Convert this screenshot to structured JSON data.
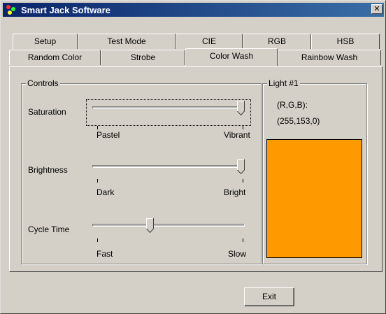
{
  "window": {
    "title": "Smart Jack Software",
    "close_label": "✕"
  },
  "tabs_row1": [
    {
      "label": "Setup"
    },
    {
      "label": "Test Mode"
    },
    {
      "label": "CIE"
    },
    {
      "label": "RGB"
    },
    {
      "label": "HSB"
    }
  ],
  "tabs_row2": [
    {
      "label": "Random Color"
    },
    {
      "label": "Strobe"
    },
    {
      "label": "Color Wash",
      "active": true
    },
    {
      "label": "Rainbow Wash"
    }
  ],
  "controls": {
    "group_label": "Controls",
    "saturation": {
      "label": "Saturation",
      "min_label": "Pastel",
      "max_label": "Vibrant",
      "value": 1.0
    },
    "brightness": {
      "label": "Brightness",
      "min_label": "Dark",
      "max_label": "Bright",
      "value": 1.0
    },
    "cycle_time": {
      "label": "Cycle Time",
      "min_label": "Fast",
      "max_label": "Slow",
      "value": 0.37
    }
  },
  "light": {
    "group_label": "Light #1",
    "rgb_label": "(R,G,B):",
    "rgb_value": "(255,153,0)",
    "color": "#ff9900"
  },
  "exit_label": "Exit"
}
